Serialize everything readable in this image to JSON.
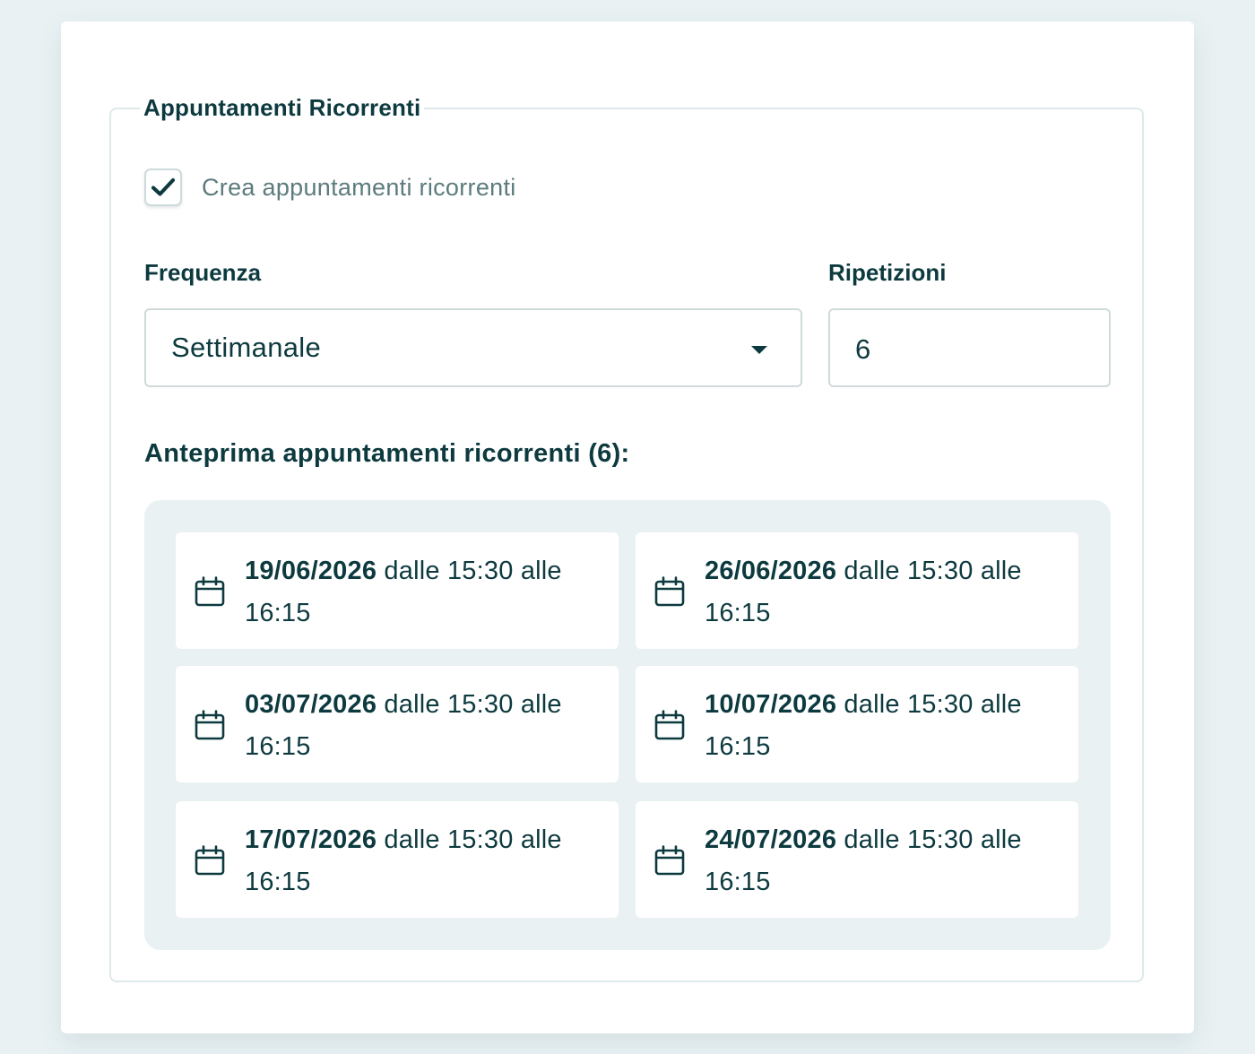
{
  "recurring": {
    "legend": "Appuntamenti Ricorrenti",
    "checkbox": {
      "label": "Crea appuntamenti ricorrenti",
      "checked": true
    },
    "frequency": {
      "label": "Frequenza",
      "value": "Settimanale"
    },
    "repetitions": {
      "label": "Ripetizioni",
      "value": "6"
    },
    "preview": {
      "title": "Anteprima appuntamenti ricorrenti (6):",
      "items": [
        {
          "date": "19/06/2026",
          "from_prefix": "dalle",
          "start": "15:30",
          "to_prefix": "alle",
          "end": "16:15"
        },
        {
          "date": "26/06/2026",
          "from_prefix": "dalle",
          "start": "15:30",
          "to_prefix": "alle",
          "end": "16:15"
        },
        {
          "date": "03/07/2026",
          "from_prefix": "dalle",
          "start": "15:30",
          "to_prefix": "alle",
          "end": "16:15"
        },
        {
          "date": "10/07/2026",
          "from_prefix": "dalle",
          "start": "15:30",
          "to_prefix": "alle",
          "end": "16:15"
        },
        {
          "date": "17/07/2026",
          "from_prefix": "dalle",
          "start": "15:30",
          "to_prefix": "alle",
          "end": "16:15"
        },
        {
          "date": "24/07/2026",
          "from_prefix": "dalle",
          "start": "15:30",
          "to_prefix": "alle",
          "end": "16:15"
        }
      ]
    }
  },
  "icons": {
    "check": "check-icon",
    "caret": "chevron-down-icon",
    "calendar": "calendar-icon"
  },
  "colors": {
    "text_primary": "#0d3a3f",
    "text_muted": "#5c7b7e",
    "page_background": "#e9f1f3",
    "card_background": "#ffffff",
    "border": "#cfdadb"
  }
}
